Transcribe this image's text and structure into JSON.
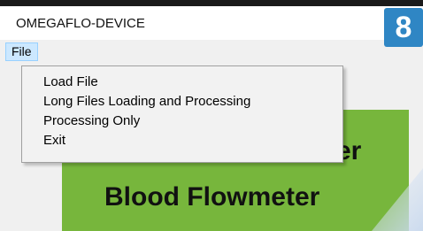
{
  "window": {
    "title": "OMEGAFLO-DEVICE"
  },
  "menu_bar": {
    "file_label": "File"
  },
  "file_menu": {
    "items": [
      {
        "label": "Load File"
      },
      {
        "label": "Long Files Loading and Processing"
      },
      {
        "label": "Processing Only"
      },
      {
        "label": "Exit"
      }
    ]
  },
  "content": {
    "banner_line_1_visible": "er",
    "banner_line_2": "Blood Flowmeter"
  },
  "step_badge": {
    "number": "8"
  },
  "colors": {
    "menu_highlight": "#cce8ff",
    "banner_green": "#77b63c",
    "badge_blue": "#2f86c4"
  }
}
